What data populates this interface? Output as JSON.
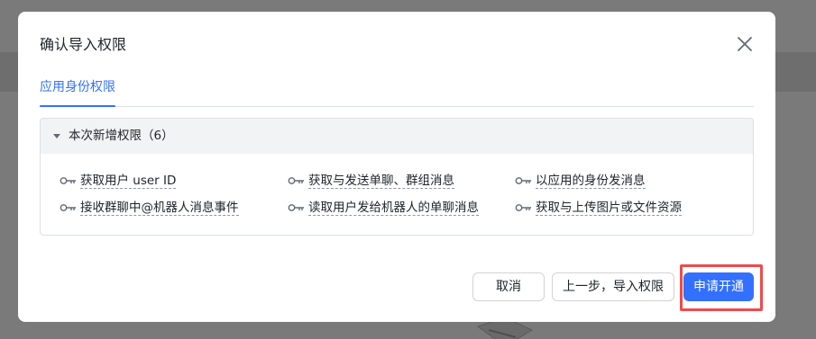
{
  "dialog": {
    "title": "确认导入权限",
    "tab_label": "应用身份权限"
  },
  "permissions": {
    "header": "本次新增权限（6）",
    "items": [
      {
        "label": "获取用户 user ID",
        "icon": "key-icon"
      },
      {
        "label": "获取与发送单聊、群组消息",
        "icon": "key-icon"
      },
      {
        "label": "以应用的身份发消息",
        "icon": "key-icon"
      },
      {
        "label": "接收群聊中@机器人消息事件",
        "icon": "key-icon"
      },
      {
        "label": "读取用户发给机器人的单聊消息",
        "icon": "key-icon"
      },
      {
        "label": "获取与上传图片或文件资源",
        "icon": "key-icon"
      }
    ]
  },
  "footer": {
    "cancel_label": "取消",
    "back_label": "上一步，导入权限",
    "submit_label": "申请开通"
  },
  "colors": {
    "accent": "#3370ff",
    "highlight": "#ee4b4b"
  }
}
